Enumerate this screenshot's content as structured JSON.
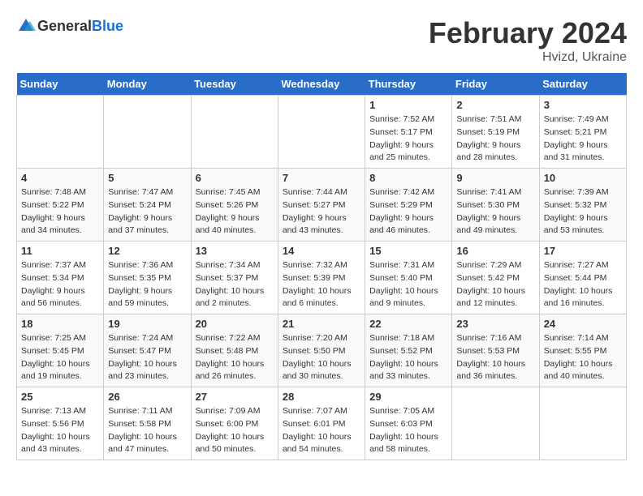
{
  "header": {
    "logo_general": "General",
    "logo_blue": "Blue",
    "title": "February 2024",
    "subtitle": "Hvizd, Ukraine"
  },
  "days_of_week": [
    "Sunday",
    "Monday",
    "Tuesday",
    "Wednesday",
    "Thursday",
    "Friday",
    "Saturday"
  ],
  "weeks": [
    [
      {
        "day": "",
        "info": ""
      },
      {
        "day": "",
        "info": ""
      },
      {
        "day": "",
        "info": ""
      },
      {
        "day": "",
        "info": ""
      },
      {
        "day": "1",
        "info": "Sunrise: 7:52 AM\nSunset: 5:17 PM\nDaylight: 9 hours\nand 25 minutes."
      },
      {
        "day": "2",
        "info": "Sunrise: 7:51 AM\nSunset: 5:19 PM\nDaylight: 9 hours\nand 28 minutes."
      },
      {
        "day": "3",
        "info": "Sunrise: 7:49 AM\nSunset: 5:21 PM\nDaylight: 9 hours\nand 31 minutes."
      }
    ],
    [
      {
        "day": "4",
        "info": "Sunrise: 7:48 AM\nSunset: 5:22 PM\nDaylight: 9 hours\nand 34 minutes."
      },
      {
        "day": "5",
        "info": "Sunrise: 7:47 AM\nSunset: 5:24 PM\nDaylight: 9 hours\nand 37 minutes."
      },
      {
        "day": "6",
        "info": "Sunrise: 7:45 AM\nSunset: 5:26 PM\nDaylight: 9 hours\nand 40 minutes."
      },
      {
        "day": "7",
        "info": "Sunrise: 7:44 AM\nSunset: 5:27 PM\nDaylight: 9 hours\nand 43 minutes."
      },
      {
        "day": "8",
        "info": "Sunrise: 7:42 AM\nSunset: 5:29 PM\nDaylight: 9 hours\nand 46 minutes."
      },
      {
        "day": "9",
        "info": "Sunrise: 7:41 AM\nSunset: 5:30 PM\nDaylight: 9 hours\nand 49 minutes."
      },
      {
        "day": "10",
        "info": "Sunrise: 7:39 AM\nSunset: 5:32 PM\nDaylight: 9 hours\nand 53 minutes."
      }
    ],
    [
      {
        "day": "11",
        "info": "Sunrise: 7:37 AM\nSunset: 5:34 PM\nDaylight: 9 hours\nand 56 minutes."
      },
      {
        "day": "12",
        "info": "Sunrise: 7:36 AM\nSunset: 5:35 PM\nDaylight: 9 hours\nand 59 minutes."
      },
      {
        "day": "13",
        "info": "Sunrise: 7:34 AM\nSunset: 5:37 PM\nDaylight: 10 hours\nand 2 minutes."
      },
      {
        "day": "14",
        "info": "Sunrise: 7:32 AM\nSunset: 5:39 PM\nDaylight: 10 hours\nand 6 minutes."
      },
      {
        "day": "15",
        "info": "Sunrise: 7:31 AM\nSunset: 5:40 PM\nDaylight: 10 hours\nand 9 minutes."
      },
      {
        "day": "16",
        "info": "Sunrise: 7:29 AM\nSunset: 5:42 PM\nDaylight: 10 hours\nand 12 minutes."
      },
      {
        "day": "17",
        "info": "Sunrise: 7:27 AM\nSunset: 5:44 PM\nDaylight: 10 hours\nand 16 minutes."
      }
    ],
    [
      {
        "day": "18",
        "info": "Sunrise: 7:25 AM\nSunset: 5:45 PM\nDaylight: 10 hours\nand 19 minutes."
      },
      {
        "day": "19",
        "info": "Sunrise: 7:24 AM\nSunset: 5:47 PM\nDaylight: 10 hours\nand 23 minutes."
      },
      {
        "day": "20",
        "info": "Sunrise: 7:22 AM\nSunset: 5:48 PM\nDaylight: 10 hours\nand 26 minutes."
      },
      {
        "day": "21",
        "info": "Sunrise: 7:20 AM\nSunset: 5:50 PM\nDaylight: 10 hours\nand 30 minutes."
      },
      {
        "day": "22",
        "info": "Sunrise: 7:18 AM\nSunset: 5:52 PM\nDaylight: 10 hours\nand 33 minutes."
      },
      {
        "day": "23",
        "info": "Sunrise: 7:16 AM\nSunset: 5:53 PM\nDaylight: 10 hours\nand 36 minutes."
      },
      {
        "day": "24",
        "info": "Sunrise: 7:14 AM\nSunset: 5:55 PM\nDaylight: 10 hours\nand 40 minutes."
      }
    ],
    [
      {
        "day": "25",
        "info": "Sunrise: 7:13 AM\nSunset: 5:56 PM\nDaylight: 10 hours\nand 43 minutes."
      },
      {
        "day": "26",
        "info": "Sunrise: 7:11 AM\nSunset: 5:58 PM\nDaylight: 10 hours\nand 47 minutes."
      },
      {
        "day": "27",
        "info": "Sunrise: 7:09 AM\nSunset: 6:00 PM\nDaylight: 10 hours\nand 50 minutes."
      },
      {
        "day": "28",
        "info": "Sunrise: 7:07 AM\nSunset: 6:01 PM\nDaylight: 10 hours\nand 54 minutes."
      },
      {
        "day": "29",
        "info": "Sunrise: 7:05 AM\nSunset: 6:03 PM\nDaylight: 10 hours\nand 58 minutes."
      },
      {
        "day": "",
        "info": ""
      },
      {
        "day": "",
        "info": ""
      }
    ]
  ]
}
